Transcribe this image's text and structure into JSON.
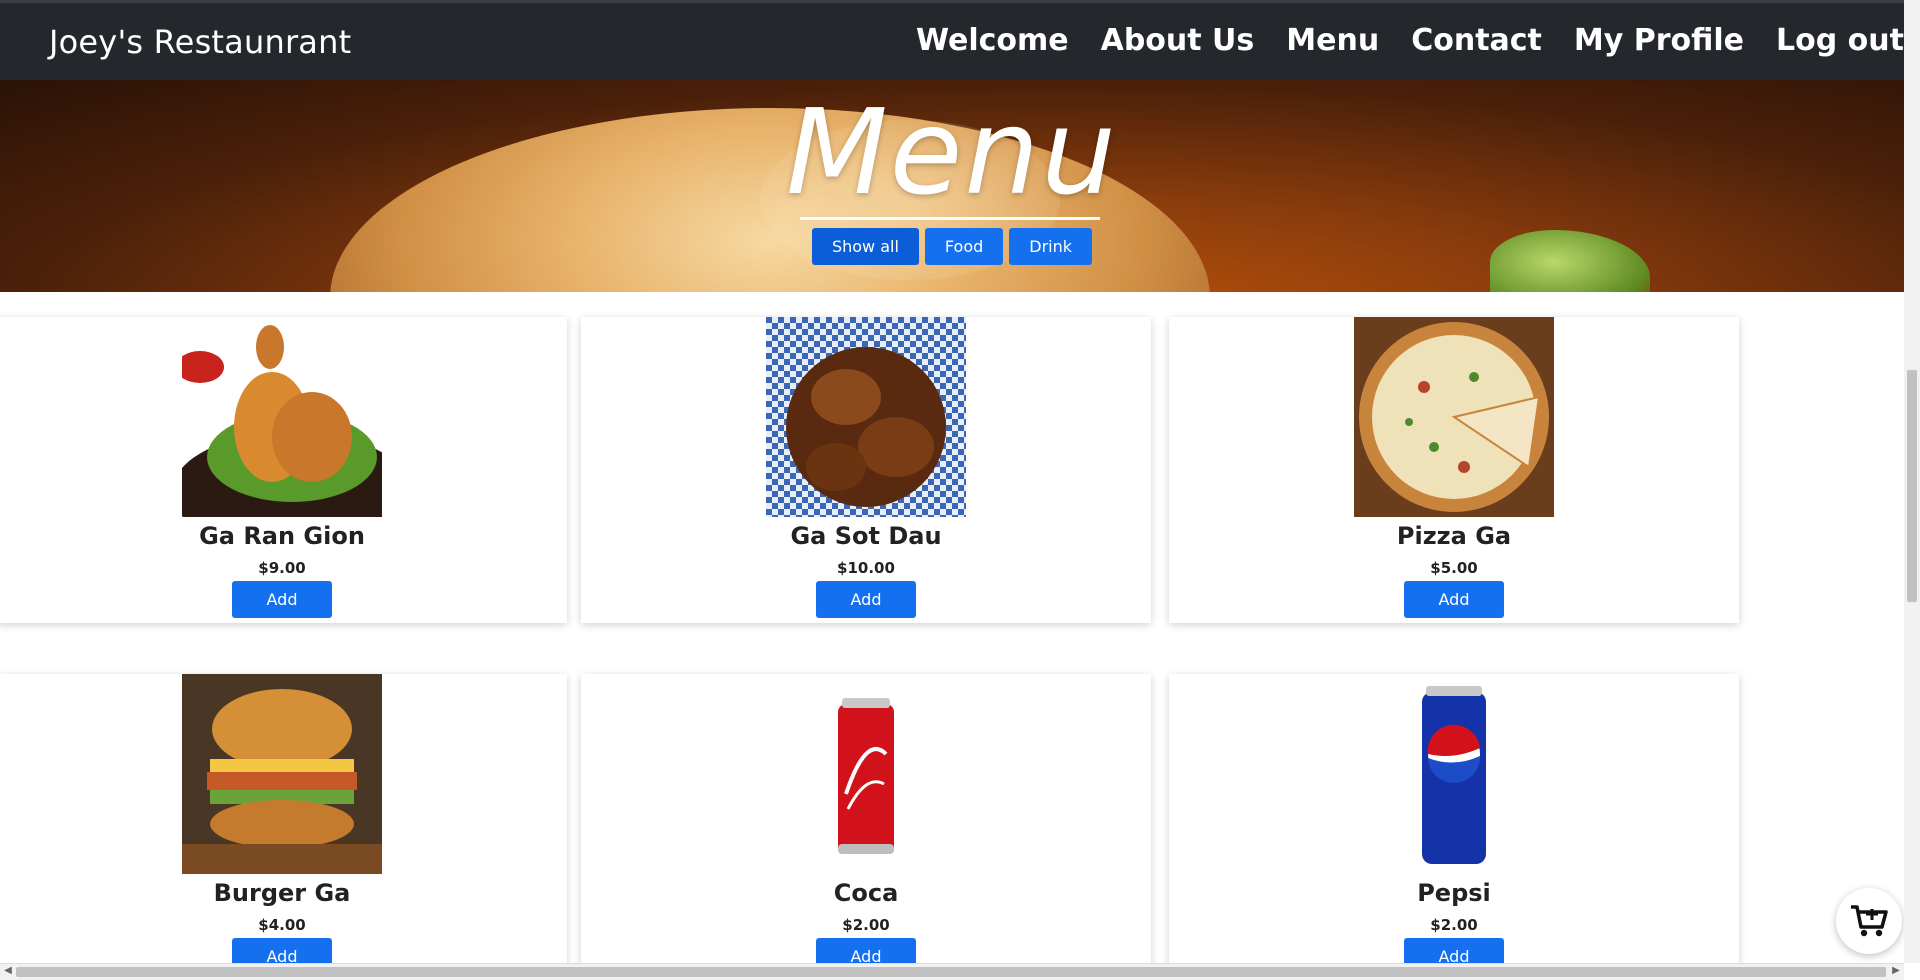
{
  "navbar": {
    "brand": "Joey's Restaunrant",
    "links": [
      "Welcome",
      "About Us",
      "Menu",
      "Contact",
      "My Profile",
      "Log out"
    ]
  },
  "hero": {
    "title": "Menu",
    "filters": [
      "Show all",
      "Food",
      "Drink"
    ],
    "active_filter": "Show all"
  },
  "menu_items": [
    {
      "name": "Ga Ran Gion",
      "price": "$9.00",
      "button": "Add",
      "image": "fried-chicken-image"
    },
    {
      "name": "Ga Sot Dau",
      "price": "$10.00",
      "button": "Add",
      "image": "sauce-chicken-wings-image"
    },
    {
      "name": "Pizza Ga",
      "price": "$5.00",
      "button": "Add",
      "image": "chicken-pizza-image"
    },
    {
      "name": "Burger Ga",
      "price": "$4.00",
      "button": "Add",
      "image": "chicken-burger-image"
    },
    {
      "name": "Coca",
      "price": "$2.00",
      "button": "Add",
      "image": "coca-cola-can-image"
    },
    {
      "name": "Pepsi",
      "price": "$2.00",
      "button": "Add",
      "image": "pepsi-can-image"
    }
  ],
  "cart": {
    "icon": "cart-plus-icon"
  },
  "colors": {
    "navbar": "#24272b",
    "primary_button": "#1570ef"
  }
}
